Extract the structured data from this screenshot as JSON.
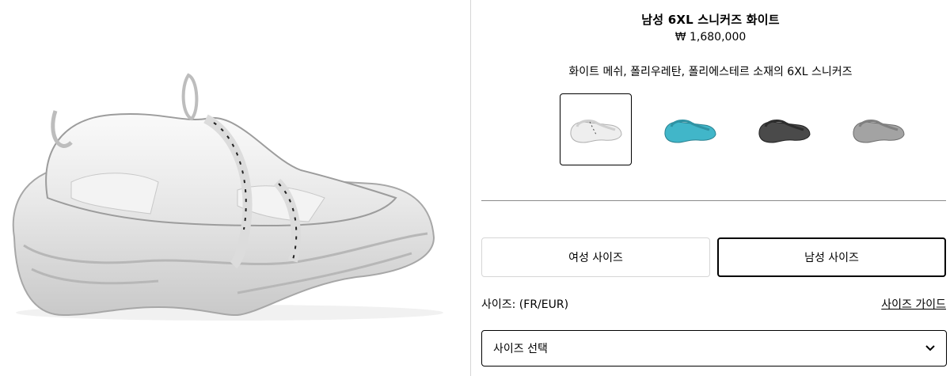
{
  "product": {
    "name": "남성 6XL 스니커즈 화이트",
    "price": "₩ 1,680,000",
    "description": "화이트 메쉬, 폴리우레탄, 폴리에스테르 소재의 6XL 스니커즈"
  },
  "colors": [
    {
      "name": "white-swatch",
      "color": "#e9e9e9",
      "selected": true
    },
    {
      "name": "turquoise-swatch",
      "color": "#3fb3c6",
      "selected": false
    },
    {
      "name": "black-swatch",
      "color": "#4a4a4a",
      "selected": false
    },
    {
      "name": "grey-swatch",
      "color": "#9a9a9a",
      "selected": false
    }
  ],
  "size_tabs": {
    "women": "여성 사이즈",
    "men": "남성 사이즈"
  },
  "size": {
    "label": "사이즈: (FR/EUR)",
    "guide": "사이즈 가이드",
    "select_placeholder": "사이즈 선택"
  },
  "icons": {
    "select_arrow": "chevron-down-icon"
  }
}
